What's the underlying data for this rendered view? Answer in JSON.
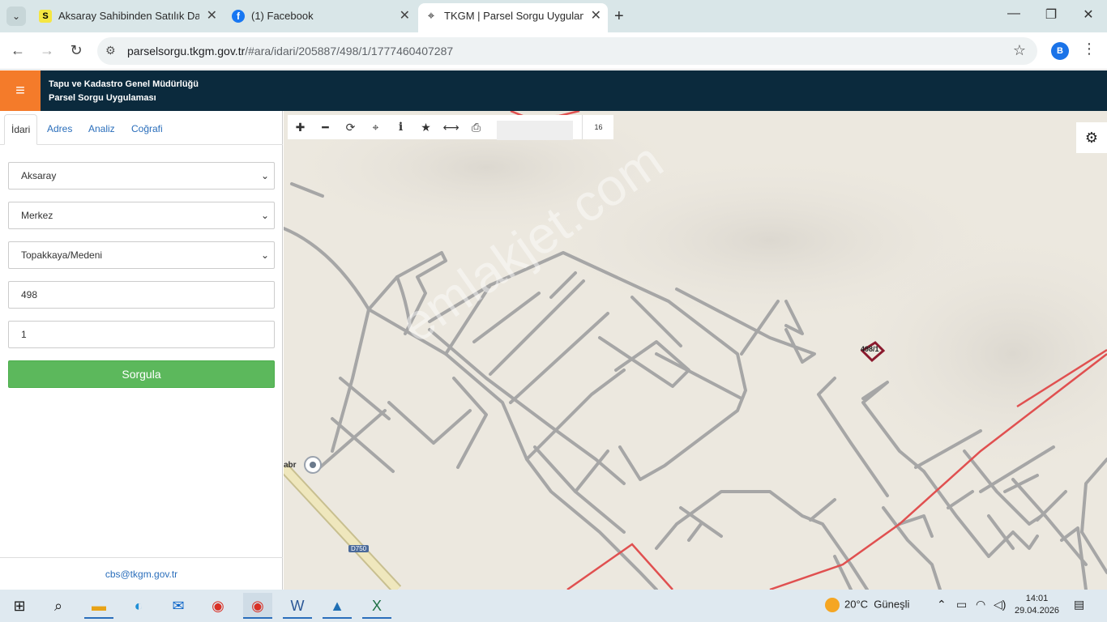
{
  "browser": {
    "tabs": [
      {
        "title": "Aksaray Sahibinden Satılık Daire",
        "favicon_letter": "S",
        "favicon_color": "#f5e642"
      },
      {
        "title": "(1) Facebook",
        "favicon_letter": "f",
        "favicon_color": "#1877f2"
      },
      {
        "title": "TKGM | Parsel Sorgu Uygulaması",
        "favicon_letter": "⌖",
        "favicon_color": "#ffffff"
      }
    ],
    "active_tab": 2,
    "url_host": "parselsorgu.tkgm.gov.tr",
    "url_path": "/#ara/idari/205887/498/1/1777460407287",
    "profile_initial": "B"
  },
  "app": {
    "title_line1": "Tapu ve Kadastro Genel Müdürlüğü",
    "title_line2": "Parsel Sorgu Uygulaması",
    "header_color": "#0b2a3d",
    "menu_color": "#f47b2a"
  },
  "panel": {
    "tabs": [
      "İdari",
      "Adres",
      "Analiz",
      "Coğrafi"
    ],
    "active_tab": "İdari",
    "il": "Aksaray",
    "ilce": "Merkez",
    "mahalle": "Topakkaya/Medeni",
    "ada": "498",
    "parsel": "1",
    "submit_label": "Sorgula",
    "contact_email": "cbs@tkgm.gov.tr"
  },
  "map": {
    "zoom_level": "16",
    "parcel_label": "498/1",
    "road_label": "D750",
    "place_label": "abr",
    "watermark": "emlakjet.com"
  },
  "taskbar": {
    "weather_temp": "20°C",
    "weather_text": "Güneşli",
    "time": "14:01",
    "date": "29.04.2026"
  }
}
